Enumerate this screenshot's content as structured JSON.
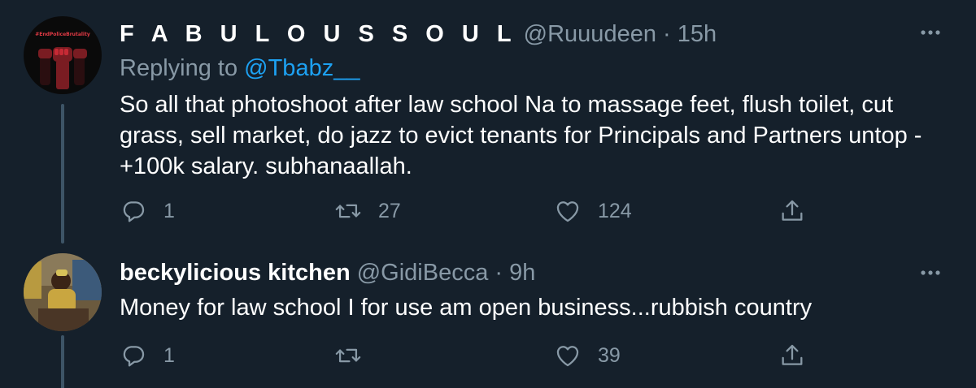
{
  "tweets": [
    {
      "display_name": "F A B U L O U S S O U L",
      "handle": "@Ruuudeen",
      "separator": "·",
      "time": "15h",
      "replying_prefix": "Replying to ",
      "replying_to": "@Tbabz__",
      "text": "So all that photoshoot after law school Na to massage feet, flush toilet, cut grass, sell market, do jazz to evict tenants for Principals and Partners untop -+100k salary. subhanaallah.",
      "avatar_badge": "#EndPoliceBrutality",
      "replies": "1",
      "retweets": "27",
      "likes": "124"
    },
    {
      "display_name": "beckylicious kitchen",
      "handle": "@GidiBecca",
      "separator": "·",
      "time": "9h",
      "text": "Money for law school I for use am open business...rubbish country",
      "replies": "1",
      "retweets": "",
      "likes": "39"
    }
  ],
  "icons": {
    "reply": "reply-icon",
    "retweet": "retweet-icon",
    "like": "heart-icon",
    "share": "share-icon",
    "more": "more-icon"
  },
  "colors": {
    "background": "#15202b",
    "secondary_text": "#8899a6",
    "link": "#1da1f2",
    "thread_line": "#3d5466"
  }
}
